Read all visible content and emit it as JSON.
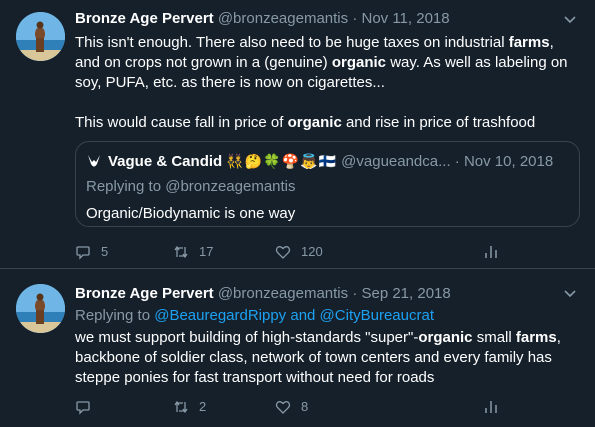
{
  "tweets": [
    {
      "name": "Bronze Age Pervert",
      "handle": "@bronzeagemantis",
      "sep": "·",
      "date": "Nov 11, 2018",
      "body": {
        "p1": [
          {
            "t": "This isn't enough. There also need to be huge taxes on industrial "
          },
          {
            "t": "farms",
            "b": true
          },
          {
            "t": ", and on crops not grown in a (genuine) "
          },
          {
            "t": "organic",
            "b": true
          },
          {
            "t": " way. As well as labeling on soy, PUFA, etc. as there is now on cigarettes..."
          }
        ],
        "p2": [
          {
            "t": "This would cause fall in price of "
          },
          {
            "t": "organic",
            "b": true
          },
          {
            "t": " and rise in price of trashfood"
          }
        ]
      },
      "quote": {
        "name": "Vague & Candid",
        "emojis": [
          "👯",
          "🤔",
          "🍀",
          "🍄",
          "👼",
          "🇫🇮"
        ],
        "handle": "@vagueandca...",
        "sep": "·",
        "date": "Nov 10, 2018",
        "replying_to": "Replying to @bronzeagemantis",
        "text": "Organic/Biodynamic is one way"
      },
      "actions": {
        "reply_count": "5",
        "retweet_count": "17",
        "like_count": "120"
      }
    },
    {
      "name": "Bronze Age Pervert",
      "handle": "@bronzeagemantis",
      "sep": "·",
      "date": "Sep 21, 2018",
      "replying_prefix": "Replying to ",
      "replying_users": "@BeauregardRippy and @CityBureaucrat",
      "body": [
        {
          "t": "we must support building of high-standards \"super\"-"
        },
        {
          "t": "organic",
          "b": true
        },
        {
          "t": " small "
        },
        {
          "t": "farms",
          "b": true
        },
        {
          "t": ", backbone of soldier class, network of town centers and every family has steppe ponies for fast transport without need for roads"
        }
      ],
      "actions": {
        "reply_count": "",
        "retweet_count": "2",
        "like_count": "8"
      }
    }
  ],
  "colors": {
    "background": "#15202b",
    "muted": "#8899a6",
    "link": "#1da1f2",
    "border": "#38444d"
  },
  "icons": {
    "reply": "reply-icon",
    "retweet": "retweet-icon",
    "like": "heart-icon",
    "analytics": "analytics-icon",
    "caret": "chevron-down-icon"
  }
}
